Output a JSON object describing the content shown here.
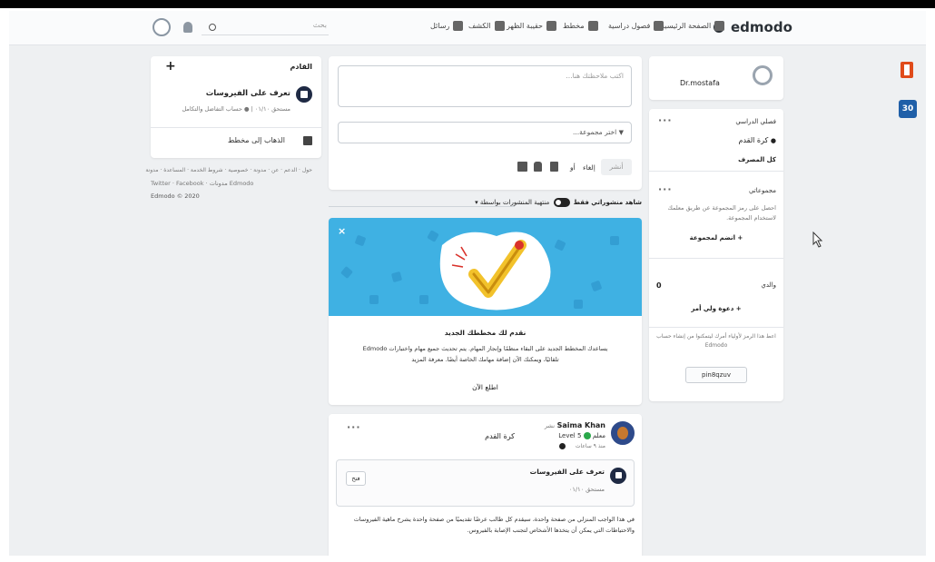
{
  "nav": {
    "logo": "edmodo",
    "items": [
      {
        "label": "الصفحة الرئيسية",
        "icon": "home-icon"
      },
      {
        "label": "فصول دراسية",
        "icon": "classes-icon"
      },
      {
        "label": "مخطط",
        "icon": "planner-icon"
      },
      {
        "label": "حقيبة الظهر",
        "icon": "backpack-icon"
      },
      {
        "label": "الكشف",
        "icon": "discover-icon"
      },
      {
        "label": "رسائل",
        "icon": "messages-icon"
      }
    ],
    "search_placeholder": "بحث"
  },
  "left_sidebar": {
    "title": "القادم",
    "event": {
      "title": "تعرف على الفيروسات",
      "meta": "مستحق ٠١/١٠ | ● حساب التفاضل والتكامل"
    },
    "planner_link": "الذهاب إلى مخطط",
    "footer_links": "حول · الدعم · عن · مدونة · خصوصية · شروط الخدمة · المساعدة · مدونة",
    "footer_social": "Twitter · Facebook · مدونات Edmodo",
    "copyright": "Edmodo © 2020"
  },
  "composer": {
    "placeholder": "اكتب ملاحظتك هنا...",
    "group_select": "اختر مجموعة...",
    "cancel_label": "إلغاء",
    "or_label": "أو",
    "send_label": "أنشر"
  },
  "filter": {
    "label": "شاهد منشوراتي فقط",
    "toggle_label": "منتهية المنشورات بواسطة ▾"
  },
  "promo": {
    "title": "نقدم لك مخططك الجديد",
    "body": "يساعدك المخطط الجديد على البقاء منظمًا وإنجاز المهام. يتم تحديث جميع مهام واختبارات Edmodo تلقائيًا، ويمكنك الآن إضافة مهامك الخاصة أيضًا. معرفة المزيد",
    "cta": "اطلع الآن"
  },
  "post": {
    "author": "Saima Khan",
    "author_suffix": "نشر",
    "role": "معلم",
    "level": "Level 5",
    "audience": "كرة القدم",
    "time": "منذ ٩ ساعات",
    "assignment": {
      "title": "تعرف على الفيروسات",
      "due": "مستحق ٠١/١٠",
      "open_label": "فتح"
    },
    "text": "في هذا الواجب المنزلي من صفحة واحدة، سيقدم كل طالب عرضًا تقديميًا من صفحة واحدة يشرح ماهية الفيروسات والاحتياطات التي يمكن أن يتخذها الأشخاص لتجنب الإصابة بالفيروس."
  },
  "profile": {
    "name": "Dr.mostafa"
  },
  "classes": {
    "title": "فصلي الدراسي",
    "items": [
      "كرة القدم"
    ],
    "view_all": "كل المصرف"
  },
  "groups": {
    "title": "مجموعاتي",
    "text": "احصل على رمز المجموعة عن طريق معلمك لاستخدام المجموعة.",
    "join": "+ انضم لمجموعة"
  },
  "parents": {
    "title": "والدي",
    "count": "0",
    "invite": "+ دعوة ولي أمر",
    "note": "اعط هذا الرمز لأولياء أمرك ليتمكنوا من إنشاء حساب Edmodo",
    "code": "pin8qzuv"
  },
  "colors": {
    "accent": "#1c8ad1",
    "promo_bg": "#3fb1e3",
    "logo": "#2b3137"
  }
}
